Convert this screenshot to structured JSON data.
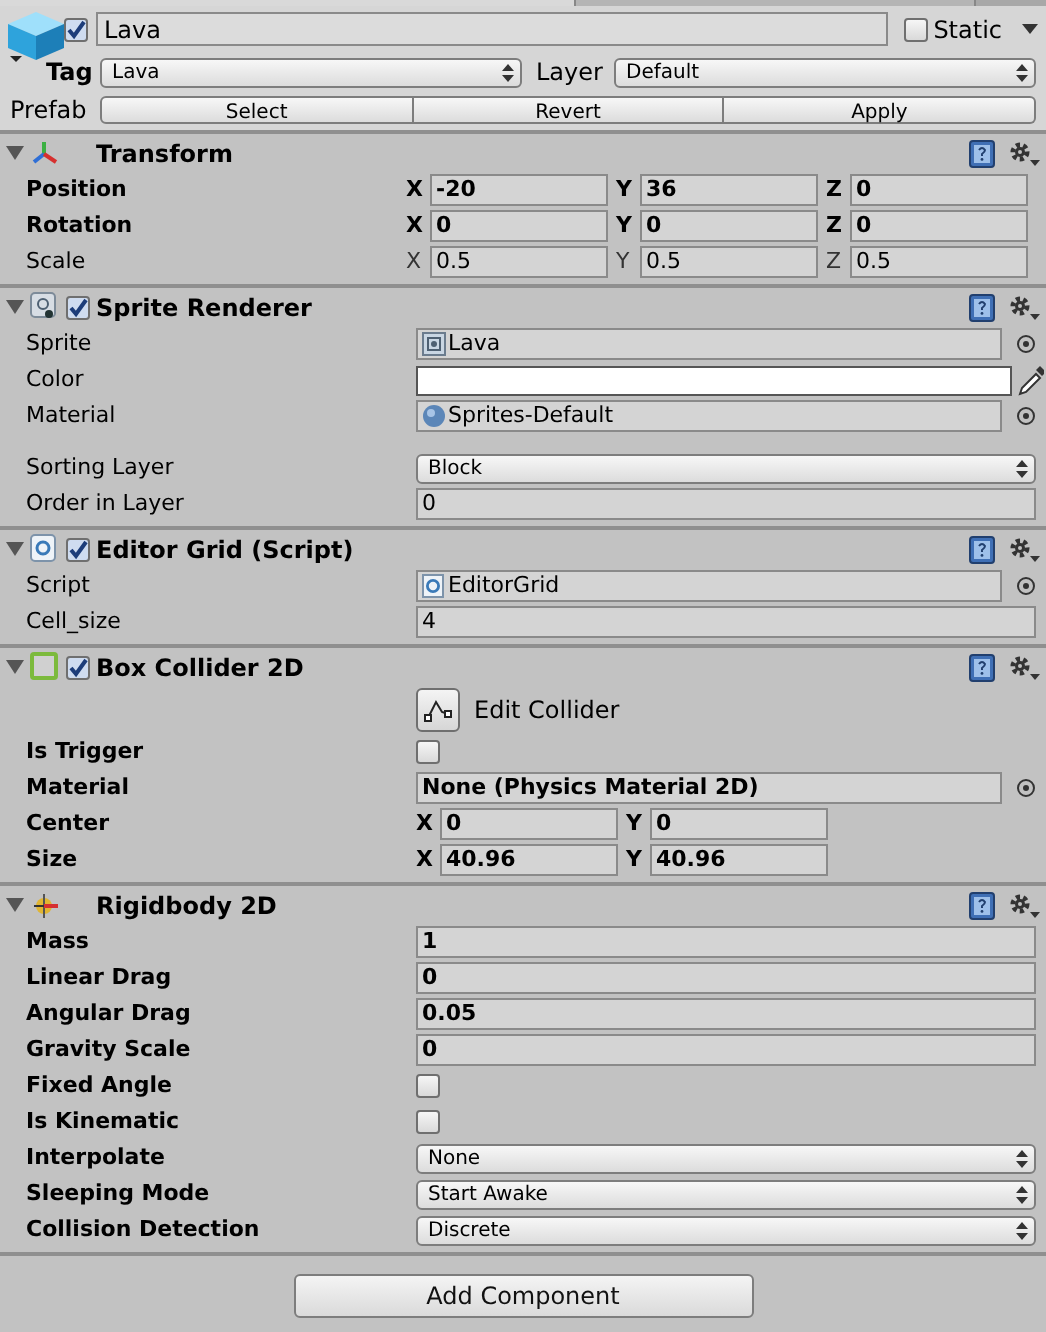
{
  "header": {
    "active": true,
    "name": "Lava",
    "static_label": "Static",
    "static": false,
    "tag_label": "Tag",
    "tag": "Lava",
    "layer_label": "Layer",
    "layer": "Default",
    "prefab_label": "Prefab",
    "prefab_buttons": [
      "Select",
      "Revert",
      "Apply"
    ]
  },
  "components": [
    {
      "kind": "transform",
      "title": "Transform",
      "expanded": true,
      "fields": [
        {
          "kind": "vector",
          "label": "Position",
          "modified": true,
          "axes": [
            {
              "axis": "X",
              "value": "-20"
            },
            {
              "axis": "Y",
              "value": "36"
            },
            {
              "axis": "Z",
              "value": "0"
            }
          ]
        },
        {
          "kind": "vector",
          "label": "Rotation",
          "modified": true,
          "axes": [
            {
              "axis": "X",
              "value": "0"
            },
            {
              "axis": "Y",
              "value": "0"
            },
            {
              "axis": "Z",
              "value": "0"
            }
          ]
        },
        {
          "kind": "vector",
          "label": "Scale",
          "modified": false,
          "axes": [
            {
              "axis": "X",
              "value": "0.5"
            },
            {
              "axis": "Y",
              "value": "0.5"
            },
            {
              "axis": "Z",
              "value": "0.5"
            }
          ]
        }
      ]
    },
    {
      "kind": "sprite",
      "title": "Sprite Renderer",
      "enabled": true,
      "expanded": true,
      "fields": [
        {
          "kind": "sprite_object",
          "label": "Sprite",
          "modified": false,
          "value": "Lava"
        },
        {
          "kind": "color",
          "label": "Color",
          "modified": false,
          "color": "#ffffff"
        },
        {
          "kind": "material_object",
          "label": "Material",
          "modified": false,
          "value": "Sprites-Default"
        },
        {
          "kind": "spacer"
        },
        {
          "kind": "dropdown",
          "label": "Sorting Layer",
          "modified": false,
          "value": "Block"
        },
        {
          "kind": "number",
          "label": "Order in Layer",
          "modified": false,
          "value": "0"
        }
      ]
    },
    {
      "kind": "script",
      "title": "Editor Grid (Script)",
      "enabled": true,
      "expanded": true,
      "fields": [
        {
          "kind": "script_object",
          "label": "Script",
          "modified": false,
          "value": "EditorGrid"
        },
        {
          "kind": "number",
          "label": "Cell_size",
          "modified": false,
          "value": "4"
        }
      ]
    },
    {
      "kind": "collider",
      "title": "Box Collider 2D",
      "enabled": true,
      "expanded": true,
      "fields": [
        {
          "kind": "button",
          "value": "Edit Collider"
        },
        {
          "kind": "checkbox",
          "label": "Is Trigger",
          "modified": true,
          "checked": false
        },
        {
          "kind": "empty_object",
          "label": "Material",
          "modified": true,
          "value": "None (Physics Material 2D)"
        },
        {
          "kind": "vector",
          "label": "Center",
          "modified": true,
          "axes": [
            {
              "axis": "X",
              "value": "0"
            },
            {
              "axis": "Y",
              "value": "0"
            }
          ]
        },
        {
          "kind": "vector",
          "label": "Size",
          "modified": true,
          "axes": [
            {
              "axis": "X",
              "value": "40.96"
            },
            {
              "axis": "Y",
              "value": "40.96"
            }
          ]
        }
      ]
    },
    {
      "kind": "rigidbody",
      "title": "Rigidbody 2D",
      "expanded": true,
      "fields": [
        {
          "kind": "number",
          "label": "Mass",
          "modified": true,
          "value": "1"
        },
        {
          "kind": "number",
          "label": "Linear Drag",
          "modified": true,
          "value": "0"
        },
        {
          "kind": "number",
          "label": "Angular Drag",
          "modified": true,
          "value": "0.05"
        },
        {
          "kind": "number",
          "label": "Gravity Scale",
          "modified": true,
          "value": "0"
        },
        {
          "kind": "checkbox",
          "label": "Fixed Angle",
          "modified": true,
          "checked": false
        },
        {
          "kind": "checkbox",
          "label": "Is Kinematic",
          "modified": true,
          "checked": false
        },
        {
          "kind": "dropdown",
          "label": "Interpolate",
          "modified": true,
          "value": "None"
        },
        {
          "kind": "dropdown",
          "label": "Sleeping Mode",
          "modified": true,
          "value": "Start Awake"
        },
        {
          "kind": "dropdown",
          "label": "Collision Detection",
          "modified": true,
          "value": "Discrete"
        }
      ]
    }
  ],
  "add_component": "Add Component"
}
